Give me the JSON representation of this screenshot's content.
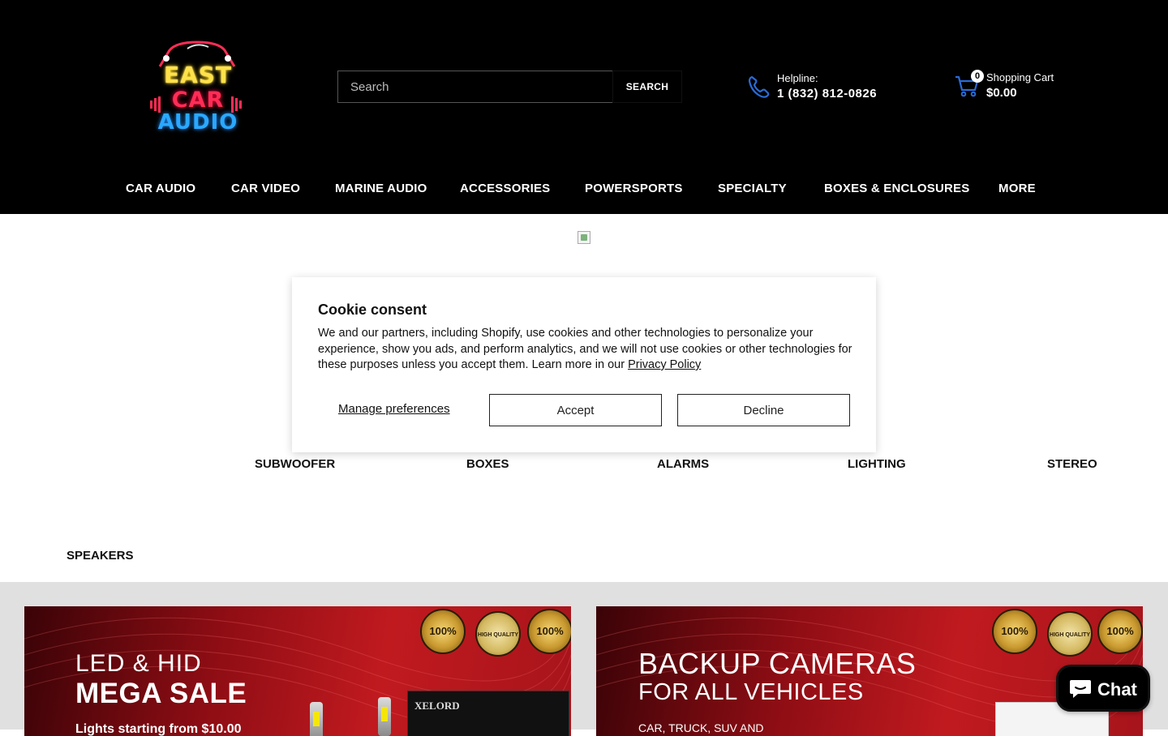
{
  "logo": {
    "line1": "EAST",
    "line2": "CAR",
    "line3": "AUDIO"
  },
  "search": {
    "placeholder": "Search",
    "button_label": "SEARCH"
  },
  "helpline": {
    "label": "Helpline:",
    "number": "1 (832) 812-0826"
  },
  "cart": {
    "count": "0",
    "label": "Shopping Cart",
    "total": "$0.00"
  },
  "nav": {
    "items": [
      {
        "label": "CAR AUDIO"
      },
      {
        "label": "CAR VIDEO"
      },
      {
        "label": "MARINE AUDIO"
      },
      {
        "label": "ACCESSORIES"
      },
      {
        "label": "POWERSPORTS"
      },
      {
        "label": "SPECIALTY"
      },
      {
        "label": "BOXES & ENCLOSURES"
      },
      {
        "label": "MORE"
      }
    ]
  },
  "categories": [
    {
      "label": "SUBWOOFER"
    },
    {
      "label": "BOXES"
    },
    {
      "label": "ALARMS"
    },
    {
      "label": "LIGHTING"
    },
    {
      "label": "STEREO"
    },
    {
      "label": "SPEAKERS"
    }
  ],
  "cookie": {
    "title": "Cookie consent",
    "body": "We and our partners, including Shopify, use cookies and other technologies to personalize your experience, show you ads, and perform analytics, and we will not use cookies or other technologies for these purposes unless you accept them. Learn more in our ",
    "privacy_link": "Privacy Policy",
    "manage_label": "Manage preferences",
    "accept_label": "Accept",
    "decline_label": "Decline"
  },
  "banners": {
    "left": {
      "line1": "LED & HID",
      "line2": "MEGA SALE",
      "line3": "Lights starting from $10.00",
      "product_brand": "XELORD"
    },
    "right": {
      "line1": "BACKUP CAMERAS",
      "line2": "FOR ALL VEHICLES",
      "line3": "CAR, TRUCK, SUV AND"
    },
    "badges": [
      "100%",
      "HIGH QUALITY",
      "100%"
    ]
  },
  "chat": {
    "label": "Chat"
  },
  "colors": {
    "header_bg": "#000000",
    "banner_red": "#b0161c",
    "accent_blue": "#2a6bd6",
    "neon_yellow": "#ffe24a",
    "neon_red": "#ff2d55",
    "neon_blue": "#2aa8ff"
  }
}
